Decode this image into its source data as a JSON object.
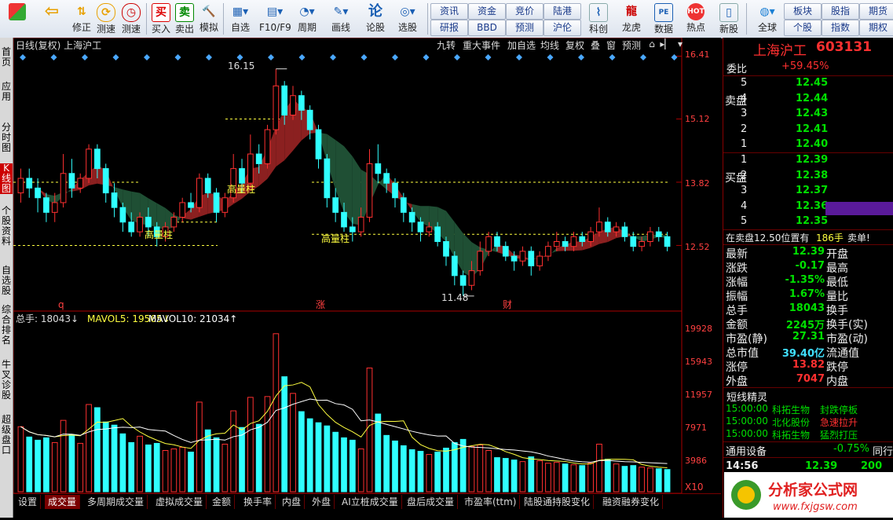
{
  "toolbar": {
    "buttons": [
      {
        "label": "",
        "icon": "start-icon"
      },
      {
        "label": "",
        "icon": "back-arrow-icon"
      },
      {
        "label": "修正",
        "icon": "up-down-arrows-icon"
      },
      {
        "label": "测速",
        "icon": "refresh-icon"
      },
      {
        "label": "测速",
        "icon": "clock-icon"
      },
      {
        "label": "买入",
        "icon": "buy-icon"
      },
      {
        "label": "卖出",
        "icon": "sell-icon"
      },
      {
        "label": "模拟",
        "icon": "gavel-icon"
      },
      {
        "label": "自选",
        "icon": "star-icon"
      },
      {
        "label": "F10/F9",
        "icon": "f10-icon"
      },
      {
        "label": "周期",
        "icon": "period-icon"
      },
      {
        "label": "画线",
        "icon": "pen-icon"
      },
      {
        "label": "论股",
        "icon": "discuss-icon"
      },
      {
        "label": "选股",
        "icon": "stock-picker-icon"
      }
    ],
    "small_buttons": [
      "资讯",
      "资金",
      "竞价",
      "陆港",
      "研报",
      "BBD",
      "预测",
      "沪伦"
    ],
    "right_buttons": [
      {
        "label": "科创",
        "icon": "chart-icon"
      },
      {
        "label": "龙虎",
        "icon": "dragon-icon"
      },
      {
        "label": "数据",
        "icon": "data-icon"
      },
      {
        "label": "热点",
        "icon": "hot-icon"
      },
      {
        "label": "新股",
        "icon": "new-stock-icon"
      },
      {
        "label": "全球",
        "icon": "globe-icon"
      }
    ],
    "far_right": [
      "板块",
      "股指",
      "期货",
      "个股",
      "指数",
      "期权"
    ]
  },
  "leftnav": [
    "首页",
    "应用",
    "分时图",
    "K线图",
    "个股资料",
    "自选股",
    "综合排名",
    "牛叉诊股",
    "超级盘口"
  ],
  "chart": {
    "title": "日线(复权) 上海沪工",
    "top_tabs": [
      "九转",
      "重大事件",
      "加自选",
      "均线",
      "复权",
      "叠",
      "窗",
      "预测"
    ],
    "price_axis": [
      "16.41",
      "15.12",
      "13.82",
      "12.52"
    ],
    "annotations": {
      "high": "16.15",
      "low": "11.48",
      "pattern1": "高量柱",
      "pattern2": "高量柱",
      "pattern3": "高量柱"
    },
    "markers": [
      "q",
      "涨",
      "财"
    ],
    "vol_legend": {
      "total": "总手: 18043↓",
      "ma5": "MAVOL5: 19565↓",
      "ma10": "MAVOL10: 21034↑"
    },
    "vol_axis": [
      "19928",
      "15943",
      "11957",
      "7971",
      "3986"
    ],
    "vol_unit": "X10"
  },
  "chart_data": {
    "type": "candlestick",
    "title": "日线(复权) 上海沪工",
    "ylim": [
      11.3,
      16.5
    ],
    "high": 16.15,
    "low": 11.48,
    "colors": {
      "up": "#ff3030",
      "down": "#30ffff",
      "cloud_up": "#8b2020",
      "cloud_down": "#1f4f34"
    },
    "volume_ylim": [
      0,
      21000
    ],
    "candles": [
      {
        "o": 13.6,
        "c": 13.9,
        "h": 14.1,
        "l": 13.4,
        "v": 8200
      },
      {
        "o": 13.9,
        "c": 13.7,
        "h": 14.1,
        "l": 13.5,
        "v": 6900
      },
      {
        "o": 13.7,
        "c": 13.5,
        "h": 13.9,
        "l": 13.2,
        "v": 6500
      },
      {
        "o": 13.5,
        "c": 13.2,
        "h": 13.6,
        "l": 13.0,
        "v": 6800
      },
      {
        "o": 13.2,
        "c": 13.4,
        "h": 13.6,
        "l": 13.0,
        "v": 6200
      },
      {
        "o": 13.4,
        "c": 14.0,
        "h": 14.4,
        "l": 13.3,
        "v": 9000
      },
      {
        "o": 14.0,
        "c": 13.7,
        "h": 14.3,
        "l": 13.5,
        "v": 7200
      },
      {
        "o": 13.7,
        "c": 13.9,
        "h": 14.0,
        "l": 13.6,
        "v": 6100
      },
      {
        "o": 13.9,
        "c": 14.5,
        "h": 14.6,
        "l": 13.8,
        "v": 11000
      },
      {
        "o": 14.5,
        "c": 14.1,
        "h": 14.6,
        "l": 13.9,
        "v": 10600
      },
      {
        "o": 14.1,
        "c": 13.6,
        "h": 14.2,
        "l": 13.4,
        "v": 8800
      },
      {
        "o": 13.6,
        "c": 13.3,
        "h": 13.8,
        "l": 13.1,
        "v": 8400
      },
      {
        "o": 13.3,
        "c": 13.0,
        "h": 13.4,
        "l": 12.8,
        "v": 7300
      },
      {
        "o": 13.0,
        "c": 12.8,
        "h": 13.2,
        "l": 12.7,
        "v": 6200
      },
      {
        "o": 12.8,
        "c": 13.1,
        "h": 13.2,
        "l": 12.7,
        "v": 7000
      },
      {
        "o": 13.1,
        "c": 12.9,
        "h": 13.3,
        "l": 12.7,
        "v": 5900
      },
      {
        "o": 12.9,
        "c": 12.7,
        "h": 13.0,
        "l": 12.5,
        "v": 6100
      },
      {
        "o": 12.7,
        "c": 12.9,
        "h": 13.0,
        "l": 12.6,
        "v": 5200
      },
      {
        "o": 12.9,
        "c": 13.1,
        "h": 13.2,
        "l": 12.8,
        "v": 5400
      },
      {
        "o": 13.1,
        "c": 13.4,
        "h": 13.5,
        "l": 13.0,
        "v": 5600
      },
      {
        "o": 13.4,
        "c": 13.3,
        "h": 13.6,
        "l": 13.2,
        "v": 5000
      },
      {
        "o": 13.3,
        "c": 13.9,
        "h": 14.0,
        "l": 13.2,
        "v": 11300
      },
      {
        "o": 13.9,
        "c": 13.6,
        "h": 14.0,
        "l": 13.5,
        "v": 7800
      },
      {
        "o": 13.6,
        "c": 13.2,
        "h": 13.7,
        "l": 13.0,
        "v": 6800
      },
      {
        "o": 13.2,
        "c": 13.5,
        "h": 13.6,
        "l": 13.1,
        "v": 6000
      },
      {
        "o": 13.5,
        "c": 14.1,
        "h": 14.4,
        "l": 13.4,
        "v": 10200
      },
      {
        "o": 14.1,
        "c": 13.8,
        "h": 14.3,
        "l": 13.6,
        "v": 8100
      },
      {
        "o": 13.8,
        "c": 14.4,
        "h": 14.8,
        "l": 13.7,
        "v": 11900
      },
      {
        "o": 14.4,
        "c": 14.2,
        "h": 14.6,
        "l": 14.0,
        "v": 8500
      },
      {
        "o": 14.2,
        "c": 14.9,
        "h": 15.0,
        "l": 14.1,
        "v": 12000
      },
      {
        "o": 14.9,
        "c": 15.8,
        "h": 16.15,
        "l": 14.8,
        "v": 19928
      },
      {
        "o": 15.8,
        "c": 15.2,
        "h": 15.9,
        "l": 15.0,
        "v": 14500
      },
      {
        "o": 15.2,
        "c": 15.6,
        "h": 15.8,
        "l": 15.1,
        "v": 12400
      },
      {
        "o": 15.6,
        "c": 15.3,
        "h": 15.7,
        "l": 15.1,
        "v": 10100
      },
      {
        "o": 15.3,
        "c": 14.9,
        "h": 15.4,
        "l": 14.7,
        "v": 9200
      },
      {
        "o": 14.9,
        "c": 14.3,
        "h": 15.0,
        "l": 14.1,
        "v": 8700
      },
      {
        "o": 14.3,
        "c": 13.5,
        "h": 14.4,
        "l": 13.3,
        "v": 8300
      },
      {
        "o": 13.5,
        "c": 13.2,
        "h": 13.7,
        "l": 13.0,
        "v": 7500
      },
      {
        "o": 13.2,
        "c": 12.9,
        "h": 13.4,
        "l": 12.8,
        "v": 6800
      },
      {
        "o": 12.9,
        "c": 12.8,
        "h": 13.1,
        "l": 12.6,
        "v": 6500
      },
      {
        "o": 12.8,
        "c": 13.1,
        "h": 13.3,
        "l": 12.7,
        "v": 5400
      },
      {
        "o": 13.1,
        "c": 14.2,
        "h": 14.5,
        "l": 13.0,
        "v": 15600
      },
      {
        "o": 14.2,
        "c": 14.0,
        "h": 14.6,
        "l": 13.8,
        "v": 9800
      },
      {
        "o": 14.0,
        "c": 13.8,
        "h": 14.1,
        "l": 13.6,
        "v": 7100
      },
      {
        "o": 13.8,
        "c": 13.5,
        "h": 13.9,
        "l": 13.3,
        "v": 6400
      },
      {
        "o": 13.5,
        "c": 13.2,
        "h": 13.6,
        "l": 13.0,
        "v": 5800
      },
      {
        "o": 13.2,
        "c": 13.0,
        "h": 13.3,
        "l": 12.8,
        "v": 5300
      },
      {
        "o": 13.0,
        "c": 12.8,
        "h": 13.1,
        "l": 12.6,
        "v": 5100
      },
      {
        "o": 12.8,
        "c": 12.9,
        "h": 13.0,
        "l": 12.7,
        "v": 4700
      },
      {
        "o": 12.9,
        "c": 12.6,
        "h": 13.0,
        "l": 12.5,
        "v": 5000
      },
      {
        "o": 12.6,
        "c": 12.3,
        "h": 12.7,
        "l": 12.1,
        "v": 5500
      },
      {
        "o": 12.3,
        "c": 11.9,
        "h": 12.4,
        "l": 11.7,
        "v": 6200
      },
      {
        "o": 11.9,
        "c": 11.7,
        "h": 12.0,
        "l": 11.48,
        "v": 6600
      },
      {
        "o": 11.7,
        "c": 12.0,
        "h": 12.2,
        "l": 11.6,
        "v": 5700
      },
      {
        "o": 12.0,
        "c": 12.4,
        "h": 12.6,
        "l": 11.9,
        "v": 5900
      },
      {
        "o": 12.4,
        "c": 12.7,
        "h": 12.8,
        "l": 12.3,
        "v": 5200
      },
      {
        "o": 12.7,
        "c": 12.5,
        "h": 12.8,
        "l": 12.4,
        "v": 4300
      },
      {
        "o": 12.5,
        "c": 12.3,
        "h": 12.6,
        "l": 12.2,
        "v": 4200
      },
      {
        "o": 12.3,
        "c": 12.2,
        "h": 12.4,
        "l": 12.0,
        "v": 4000
      },
      {
        "o": 12.2,
        "c": 12.4,
        "h": 12.5,
        "l": 12.1,
        "v": 3800
      },
      {
        "o": 12.4,
        "c": 12.1,
        "h": 12.5,
        "l": 11.9,
        "v": 4400
      },
      {
        "o": 12.1,
        "c": 12.3,
        "h": 12.4,
        "l": 12.0,
        "v": 3900
      },
      {
        "o": 12.3,
        "c": 12.5,
        "h": 12.6,
        "l": 12.2,
        "v": 3600
      },
      {
        "o": 12.5,
        "c": 12.6,
        "h": 12.8,
        "l": 12.4,
        "v": 3700
      },
      {
        "o": 12.6,
        "c": 12.5,
        "h": 12.7,
        "l": 12.4,
        "v": 3500
      },
      {
        "o": 12.5,
        "c": 12.7,
        "h": 12.8,
        "l": 12.4,
        "v": 3400
      },
      {
        "o": 12.7,
        "c": 12.6,
        "h": 12.8,
        "l": 12.5,
        "v": 3300
      },
      {
        "o": 12.6,
        "c": 12.8,
        "h": 12.9,
        "l": 12.5,
        "v": 3600
      },
      {
        "o": 12.8,
        "c": 13.0,
        "h": 13.3,
        "l": 12.7,
        "v": 6000
      },
      {
        "o": 13.0,
        "c": 12.8,
        "h": 13.1,
        "l": 12.7,
        "v": 4100
      },
      {
        "o": 12.8,
        "c": 12.9,
        "h": 13.0,
        "l": 12.7,
        "v": 3500
      },
      {
        "o": 12.9,
        "c": 12.7,
        "h": 13.0,
        "l": 12.6,
        "v": 3200
      },
      {
        "o": 12.7,
        "c": 12.5,
        "h": 12.8,
        "l": 12.4,
        "v": 3300
      },
      {
        "o": 12.5,
        "c": 12.6,
        "h": 12.7,
        "l": 12.4,
        "v": 3100
      },
      {
        "o": 12.6,
        "c": 12.8,
        "h": 12.9,
        "l": 12.5,
        "v": 3000
      },
      {
        "o": 12.8,
        "c": 12.7,
        "h": 12.9,
        "l": 12.6,
        "v": 2900
      },
      {
        "o": 12.7,
        "c": 12.5,
        "h": 12.8,
        "l": 12.4,
        "v": 2800
      }
    ]
  },
  "quote": {
    "stock_name": "上海沪工",
    "stock_code": "603131",
    "weibi_label": "委比",
    "weibi_value": "+59.45%",
    "sell_label": "卖盘",
    "buy_label": "买盘",
    "sell": [
      {
        "lvl": "5",
        "price": "12.45"
      },
      {
        "lvl": "4",
        "price": "12.44"
      },
      {
        "lvl": "3",
        "price": "12.43"
      },
      {
        "lvl": "2",
        "price": "12.41"
      },
      {
        "lvl": "1",
        "price": "12.40"
      }
    ],
    "buy": [
      {
        "lvl": "1",
        "price": "12.39"
      },
      {
        "lvl": "2",
        "price": "12.38"
      },
      {
        "lvl": "3",
        "price": "12.37"
      },
      {
        "lvl": "4",
        "price": "12.36"
      },
      {
        "lvl": "5",
        "price": "12.35"
      }
    ],
    "notice": "在卖盘12.50位置有",
    "notice_qty": "186手",
    "notice_tail": "卖单!",
    "stats": [
      {
        "l": "最新",
        "v": "12.39",
        "l2": "开盘"
      },
      {
        "l": "涨跌",
        "v": "-0.17",
        "l2": "最高"
      },
      {
        "l": "涨幅",
        "v": "-1.35%",
        "l2": "最低"
      },
      {
        "l": "振幅",
        "v": "1.67%",
        "l2": "量比"
      },
      {
        "l": "总手",
        "v": "18043",
        "l2": "换手"
      },
      {
        "l": "金额",
        "v": "2245万",
        "l2": "换手(实)"
      },
      {
        "l": "市盈(静)",
        "v": "27.31",
        "l2": "市盈(动)"
      },
      {
        "l": "总市值",
        "v": "39.40亿",
        "l2": "流通值"
      },
      {
        "l": "涨停",
        "v": "13.82",
        "l2": "跌停"
      },
      {
        "l": "外盘",
        "v": "7047",
        "l2": "内盘"
      }
    ],
    "short_title": "短线精灵",
    "short": [
      {
        "t": "15:00:00",
        "name": "科拓生物",
        "evt": "封跌停板"
      },
      {
        "t": "15:00:00",
        "name": "北化股份",
        "evt": "急速拉升"
      },
      {
        "t": "15:00:00",
        "name": "科拓生物",
        "evt": "猛烈打压"
      }
    ],
    "industry": "通用设备",
    "industry_chg": "-0.75%",
    "industry_tail": "同行",
    "tick_time": "14:56",
    "tick_price": "12.39",
    "tick_vol": "200"
  },
  "bottom_tabs": [
    "设置",
    "成交量",
    "多周期成交量",
    "虚拟成交量",
    "金额",
    "换手率",
    "内盘",
    "外盘",
    "AI立桩成交量",
    "盘后成交量",
    "市盈率(ttm)",
    "陆股通持股变化",
    "融资融券变化"
  ],
  "watermark": {
    "text": "分析家公式网",
    "url": "www.fxjgsw.com"
  }
}
